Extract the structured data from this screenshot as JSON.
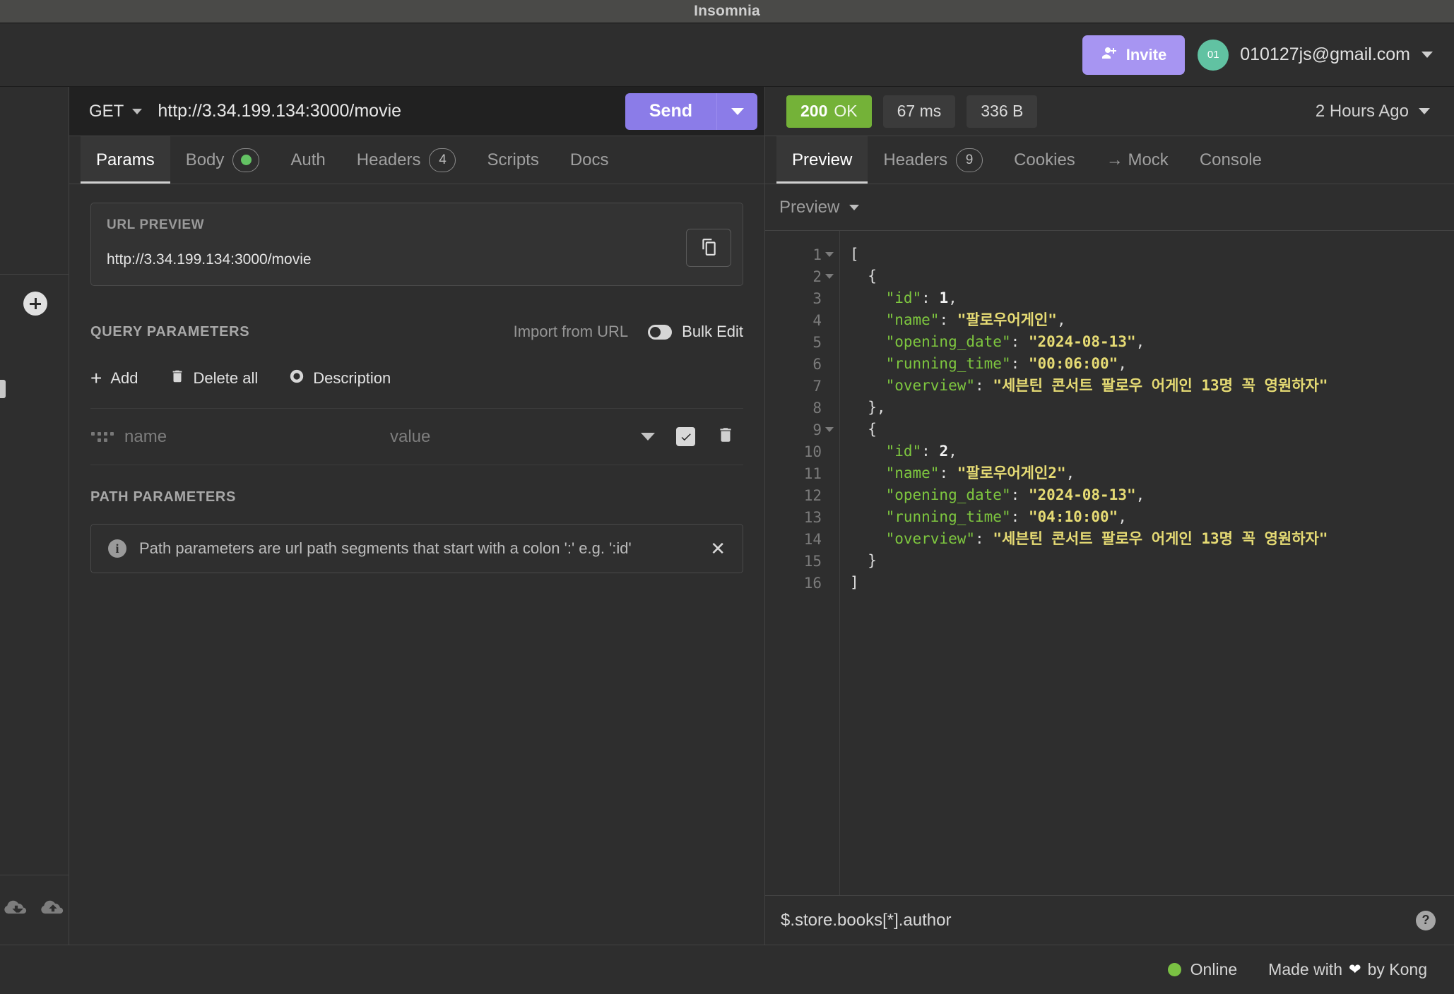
{
  "window": {
    "title": "Insomnia"
  },
  "account": {
    "invite_label": "Invite",
    "avatar_initials": "01",
    "email": "010127js@gmail.com"
  },
  "request": {
    "method": "GET",
    "url": "http://3.34.199.134:3000/movie",
    "send_label": "Send"
  },
  "response_meta": {
    "status_code": "200",
    "status_text": "OK",
    "time": "67 ms",
    "size": "336 B",
    "timestamp": "2 Hours Ago"
  },
  "request_tabs": [
    {
      "label": "Params",
      "active": true
    },
    {
      "label": "Body",
      "active": false,
      "dot": true
    },
    {
      "label": "Auth",
      "active": false
    },
    {
      "label": "Headers",
      "active": false,
      "badge": "4"
    },
    {
      "label": "Scripts",
      "active": false
    },
    {
      "label": "Docs",
      "active": false
    }
  ],
  "response_tabs": [
    {
      "label": "Preview",
      "active": true
    },
    {
      "label": "Headers",
      "active": false,
      "badge": "9"
    },
    {
      "label": "Cookies",
      "active": false
    },
    {
      "label": "→ Mock",
      "active": false
    },
    {
      "label": "Console",
      "active": false
    }
  ],
  "url_preview": {
    "label": "URL PREVIEW",
    "value": "http://3.34.199.134:3000/movie"
  },
  "query_parameters": {
    "title": "QUERY PARAMETERS",
    "import_from_url": "Import from URL",
    "bulk_edit": "Bulk Edit",
    "add_label": "Add",
    "delete_all_label": "Delete all",
    "description_label": "Description",
    "row": {
      "name_placeholder": "name",
      "value_placeholder": "value"
    }
  },
  "path_parameters": {
    "title": "PATH PARAMETERS",
    "notice": "Path parameters are url path segments that start with a colon ':' e.g. ':id'"
  },
  "preview": {
    "mode_label": "Preview",
    "lines": [
      {
        "num": "1",
        "fold": true,
        "html": "["
      },
      {
        "num": "2",
        "fold": true,
        "html": "  {"
      },
      {
        "num": "3",
        "fold": false,
        "html": "    <span class='k'>\"id\"</span><span class='p'>: </span><span class='n'>1</span><span class='p'>,</span>"
      },
      {
        "num": "4",
        "fold": false,
        "html": "    <span class='k'>\"name\"</span><span class='p'>: </span><span class='s'>\"팔로우어게인\"</span><span class='p'>,</span>"
      },
      {
        "num": "5",
        "fold": false,
        "html": "    <span class='k'>\"opening_date\"</span><span class='p'>: </span><span class='s'>\"2024-08-13\"</span><span class='p'>,</span>"
      },
      {
        "num": "6",
        "fold": false,
        "html": "    <span class='k'>\"running_time\"</span><span class='p'>: </span><span class='s'>\"00:06:00\"</span><span class='p'>,</span>"
      },
      {
        "num": "7",
        "fold": false,
        "html": "    <span class='k'>\"overview\"</span><span class='p'>: </span><span class='s'>\"세븐틴 콘서트 팔로우 어게인 13명 꼭 영원하자\"</span>"
      },
      {
        "num": "8",
        "fold": false,
        "html": "  },"
      },
      {
        "num": "9",
        "fold": true,
        "html": "  {"
      },
      {
        "num": "10",
        "fold": false,
        "html": "    <span class='k'>\"id\"</span><span class='p'>: </span><span class='n'>2</span><span class='p'>,</span>"
      },
      {
        "num": "11",
        "fold": false,
        "html": "    <span class='k'>\"name\"</span><span class='p'>: </span><span class='s'>\"팔로우어게인2\"</span><span class='p'>,</span>"
      },
      {
        "num": "12",
        "fold": false,
        "html": "    <span class='k'>\"opening_date\"</span><span class='p'>: </span><span class='s'>\"2024-08-13\"</span><span class='p'>,</span>"
      },
      {
        "num": "13",
        "fold": false,
        "html": "    <span class='k'>\"running_time\"</span><span class='p'>: </span><span class='s'>\"04:10:00\"</span><span class='p'>,</span>"
      },
      {
        "num": "14",
        "fold": false,
        "html": "    <span class='k'>\"overview\"</span><span class='p'>: </span><span class='s'>\"세븐틴 콘서트 팔로우 어게인 13명 꼭 영원하자\"</span>"
      },
      {
        "num": "15",
        "fold": false,
        "html": "  }"
      },
      {
        "num": "16",
        "fold": false,
        "html": "]"
      }
    ],
    "raw_json": [
      {
        "id": 1,
        "name": "팔로우어게인",
        "opening_date": "2024-08-13",
        "running_time": "00:06:00",
        "overview": "세븐틴 콘서트 팔로우 어게인 13명 꼭 영원하자"
      },
      {
        "id": 2,
        "name": "팔로우어게인2",
        "opening_date": "2024-08-13",
        "running_time": "04:10:00",
        "overview": "세븐틴 콘서트 팔로우 어게인 13명 꼭 영원하자"
      }
    ]
  },
  "filter": {
    "value": "$.store.books[*].author"
  },
  "footer": {
    "online_label": "Online",
    "made_with_prefix": "Made with",
    "made_with_suffix": "by Kong"
  },
  "colors": {
    "accent_purple": "#8b7ce8",
    "invite_purple": "#a795f2",
    "status_green": "#74b238",
    "online_green": "#7ac143",
    "avatar_green": "#61c2a2",
    "json_key": "#7ec73f",
    "json_string": "#e6db74"
  }
}
